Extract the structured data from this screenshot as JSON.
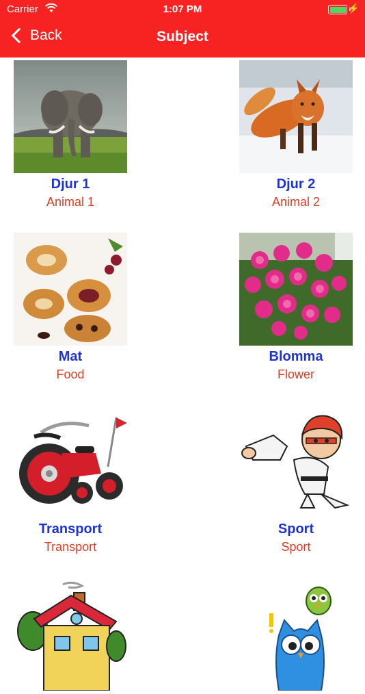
{
  "status_bar": {
    "carrier": "Carrier",
    "time": "1:07 PM"
  },
  "nav": {
    "back_label": "Back",
    "title": "Subject"
  },
  "tiles": [
    {
      "name": "Djur 1",
      "subtitle": "Animal 1",
      "icon": "elephant-photo"
    },
    {
      "name": "Djur 2",
      "subtitle": "Animal 2",
      "icon": "fox-photo"
    },
    {
      "name": "Mat",
      "subtitle": "Food",
      "icon": "pastries-photo"
    },
    {
      "name": "Blomma",
      "subtitle": "Flower",
      "icon": "peony-photo"
    },
    {
      "name": "Transport",
      "subtitle": "Transport",
      "icon": "tricycle-illustration"
    },
    {
      "name": "Sport",
      "subtitle": "Sport",
      "icon": "karate-illustration"
    },
    {
      "name": "",
      "subtitle": "",
      "icon": "house-illustration"
    },
    {
      "name": "",
      "subtitle": "",
      "icon": "owl-illustration"
    }
  ],
  "colors": {
    "header": "#f72323",
    "name_text": "#1e32d9",
    "subtitle_text": "#e23a22"
  }
}
